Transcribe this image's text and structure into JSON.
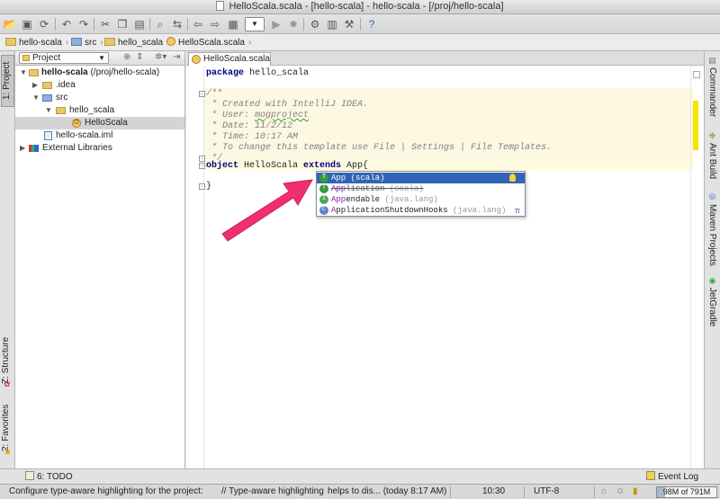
{
  "window": {
    "title": "HelloScala.scala - [hello-scala] - hello-scala - [/proj/hello-scala]"
  },
  "toolbar": {
    "icons": [
      "open-icon",
      "save-icon",
      "sync-icon",
      "undo-icon",
      "redo-icon",
      "cut-icon",
      "copy-icon",
      "paste-icon",
      "find-icon",
      "replace-icon",
      "back-icon",
      "forward-icon",
      "structure-icon",
      "run-config-dropdown",
      "run-icon",
      "debug-icon",
      "settings-icon",
      "project-structure-icon",
      "help-icon"
    ]
  },
  "navbar": {
    "crumbs": [
      "hello-scala",
      "src",
      "hello_scala",
      "HelloScala.scala"
    ]
  },
  "left_strip": {
    "project_tab": "1: Project",
    "structure_tab": "Z: Structure",
    "favorites_tab": "2: Favorites"
  },
  "project_panel": {
    "view_selector": "Project",
    "tree": [
      {
        "label": "hello-scala",
        "suffix": " (/proj/hello-scala)",
        "level": 0,
        "expanded": true,
        "icon": "folder"
      },
      {
        "label": ".idea",
        "level": 1,
        "expanded": false,
        "icon": "folder"
      },
      {
        "label": "src",
        "level": 1,
        "expanded": true,
        "icon": "folder-blue"
      },
      {
        "label": "hello_scala",
        "level": 2,
        "expanded": true,
        "icon": "folder"
      },
      {
        "label": "HelloScala",
        "level": 3,
        "icon": "class",
        "selected": true
      },
      {
        "label": "hello-scala.iml",
        "level": 1,
        "icon": "file"
      },
      {
        "label": "External Libraries",
        "level": 0,
        "expanded": false,
        "icon": "library"
      }
    ]
  },
  "editor": {
    "tab_label": "HelloScala.scala",
    "lines": {
      "l1_kw": "package",
      "l1_rest": " hello_scala",
      "c1": "/**",
      "c2": " * Created with IntelliJ IDEA.",
      "c3a": " * User: ",
      "c3b": "mogproject",
      "c4": " * Date: 11/2/12",
      "c5": " * Time: 10:17 AM",
      "c6": " * To change this template use File | Settings | File Templates.",
      "c7": " */",
      "o1_kw": "object",
      "o1_mid": " HelloScala ",
      "o1_kw2": "extends",
      "o1_rest": " App{",
      "close": "}"
    }
  },
  "completion": {
    "items": [
      {
        "match": "App",
        "rest": "",
        "loc": " (scala)",
        "kind": "trait",
        "letter": "T",
        "selected": true,
        "deprecated": false
      },
      {
        "match": "App",
        "rest": "lication",
        "loc": " (scala)",
        "kind": "trait",
        "letter": "T",
        "selected": false,
        "deprecated": true
      },
      {
        "match": "App",
        "rest": "endable",
        "loc": " (java.lang)",
        "kind": "iface",
        "letter": "I",
        "selected": false,
        "deprecated": false
      },
      {
        "match": "A",
        "rest": "pplicationShutdownHooks",
        "loc": " (java.lang)",
        "kind": "cls",
        "letter": "C",
        "selected": false,
        "deprecated": false
      }
    ],
    "pi_symbol": "π"
  },
  "right_strip": {
    "commander": "Commander",
    "ant_build": "Ant Build",
    "maven_projects": "Maven Projects",
    "jetgradle": "JetGradle"
  },
  "bottom_tools": {
    "todo": "6: TODO",
    "event_log": "Event Log"
  },
  "statusbar": {
    "message": "Configure type-aware highlighting for the project:",
    "message2": "// Type-aware highlighting",
    "message3": "helps to dis... (today 8:17 AM)",
    "position": "10:30",
    "encoding": "UTF-8",
    "memory": "98M of 791M"
  },
  "colors": {
    "accent": "#3264b6",
    "arrow": "#f0306e",
    "keyword": "#000080",
    "comment": "#808080"
  }
}
